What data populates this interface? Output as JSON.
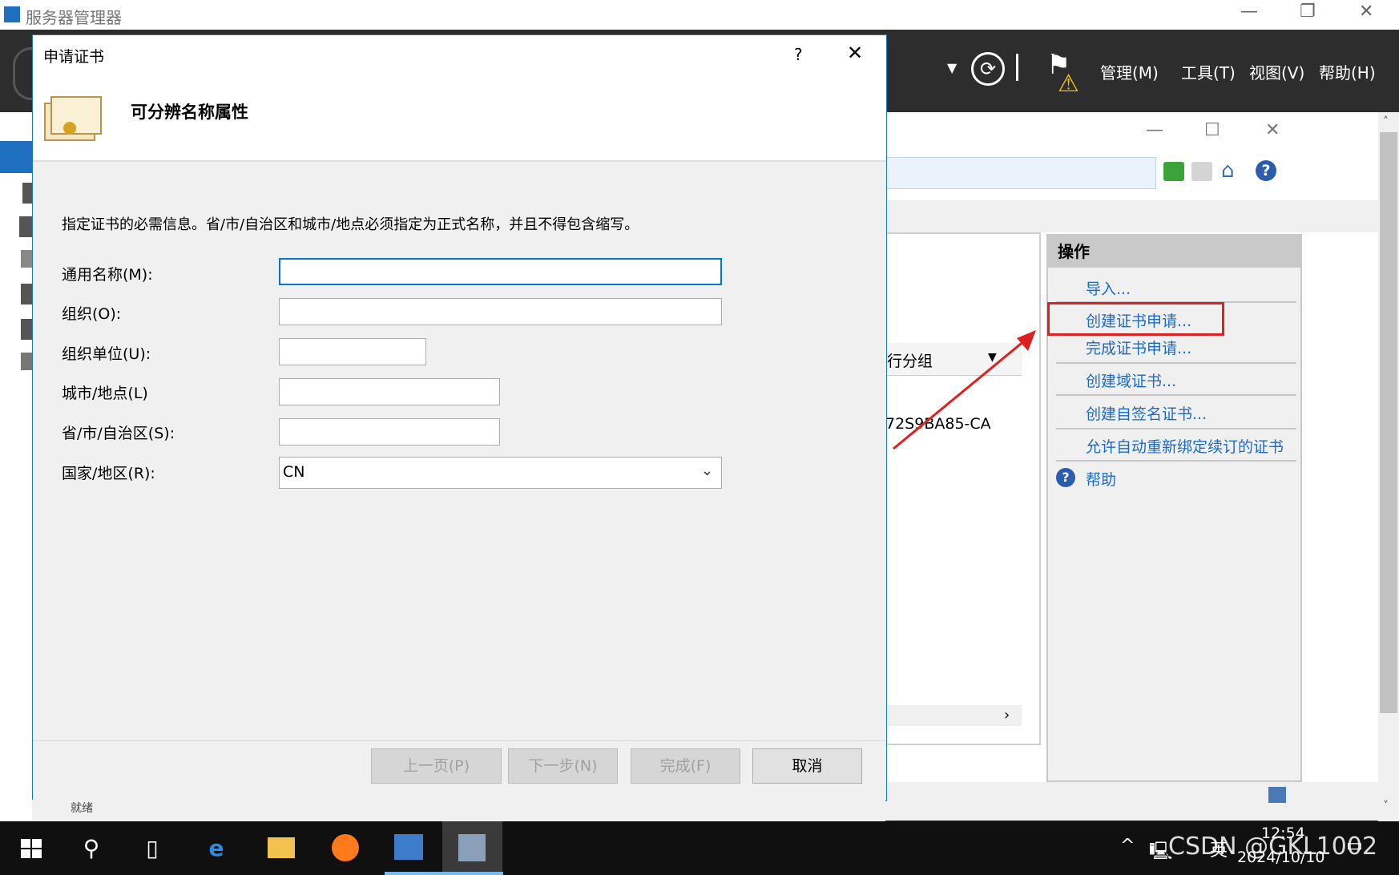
{
  "server_manager": {
    "title": "服务器管理器",
    "menus": [
      "管理(M)",
      "工具(T)",
      "视图(V)",
      "帮助(H)"
    ]
  },
  "iis": {
    "column_fragment": "行分组",
    "ca_fragment": "72S9BA85-CA",
    "status_fragment": "就绪",
    "actions_header": "操作",
    "actions": [
      "导入...",
      "创建证书申请...",
      "完成证书申请...",
      "创建域证书...",
      "创建自签名证书...",
      "允许自动重新绑定续订的证书"
    ],
    "help": "帮助",
    "highlight_color": "#e02020"
  },
  "dialog": {
    "title": "申请证书",
    "help_glyph": "?",
    "heading": "可分辨名称属性",
    "instruction": "指定证书的必需信息。省/市/自治区和城市/地点必须指定为正式名称，并且不得包含缩写。",
    "fields": [
      {
        "label": "通用名称(M):",
        "value": ""
      },
      {
        "label": "组织(O):",
        "value": ""
      },
      {
        "label": "组织单位(U):",
        "value": ""
      },
      {
        "label": "城市/地点(L)",
        "value": ""
      },
      {
        "label": "省/市/自治区(S):",
        "value": ""
      },
      {
        "label": "国家/地区(R):",
        "value": "CN"
      }
    ],
    "buttons": {
      "prev": "上一页(P)",
      "next": "下一步(N)",
      "finish": "完成(F)",
      "cancel": "取消"
    }
  },
  "taskbar": {
    "time": "12:54",
    "date": "2024/10/10",
    "ime": "英",
    "watermark": "CSDN @GKL1002"
  }
}
